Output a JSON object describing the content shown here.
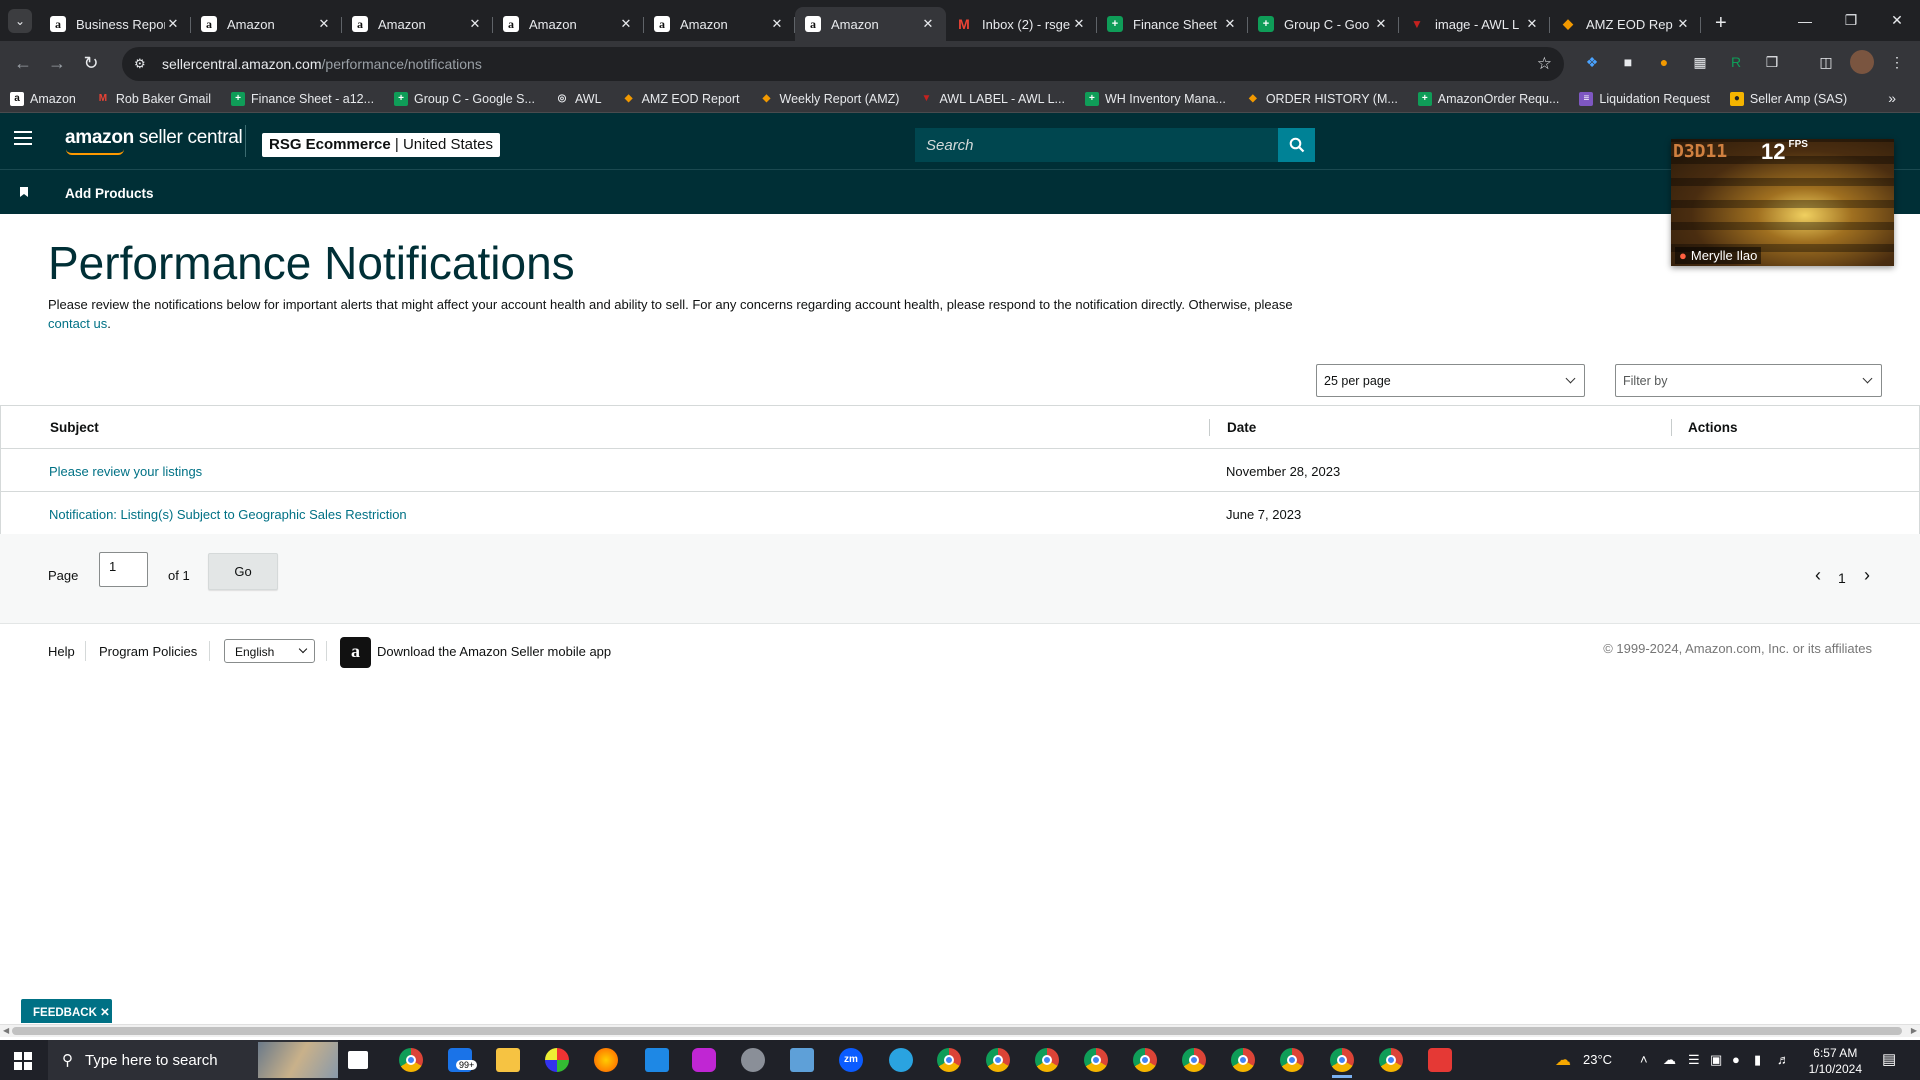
{
  "browser": {
    "tabs": [
      {
        "title": "Business Repor",
        "favicon": "amazon"
      },
      {
        "title": "Amazon",
        "favicon": "amazon"
      },
      {
        "title": "Amazon",
        "favicon": "amazon"
      },
      {
        "title": "Amazon",
        "favicon": "amazon"
      },
      {
        "title": "Amazon",
        "favicon": "amazon"
      },
      {
        "title": "Amazon",
        "favicon": "amazon",
        "active": true
      },
      {
        "title": "Inbox (2) - rsge",
        "favicon": "gmail"
      },
      {
        "title": "Finance Sheet",
        "favicon": "sheets"
      },
      {
        "title": "Group C - Goo",
        "favicon": "sheets"
      },
      {
        "title": "image - AWL L",
        "favicon": "awl"
      },
      {
        "title": "AMZ EOD Rep",
        "favicon": "eod"
      }
    ],
    "url_host": "sellercentral.amazon.com",
    "url_path": "/performance/notifications",
    "bookmarks": [
      {
        "label": "Amazon",
        "icon": "amazon"
      },
      {
        "label": "Rob Baker Gmail",
        "icon": "gmail"
      },
      {
        "label": "Finance Sheet - a12...",
        "icon": "sheets"
      },
      {
        "label": "Group C - Google S...",
        "icon": "sheets"
      },
      {
        "label": "AWL",
        "icon": "globe"
      },
      {
        "label": "AMZ EOD Report",
        "icon": "eod"
      },
      {
        "label": "Weekly Report (AMZ)",
        "icon": "eod"
      },
      {
        "label": "AWL LABEL - AWL L...",
        "icon": "awl"
      },
      {
        "label": "WH Inventory Mana...",
        "icon": "sheets"
      },
      {
        "label": "ORDER HISTORY (M...",
        "icon": "eod"
      },
      {
        "label": "AmazonOrder Requ...",
        "icon": "sheets"
      },
      {
        "label": "Liquidation Request",
        "icon": "forms"
      },
      {
        "label": "Seller Amp (SAS)",
        "icon": "selleramp"
      }
    ]
  },
  "header": {
    "logo_bold": "amazon",
    "logo_rest": " seller central",
    "store_name": "RSG Ecommerce",
    "store_sep": " | ",
    "store_region": "United States",
    "search_placeholder": "Search",
    "subnav_item": "Add Products"
  },
  "main": {
    "title": "Performance Notifications",
    "intro_text": "Please review the notifications below for important alerts that might affect your account health and ability to sell. For any concerns regarding account health, please respond to the notification directly. Otherwise, please ",
    "intro_link": "contact us",
    "intro_end": ".",
    "per_page": "25 per page",
    "filter_placeholder": "Filter by",
    "columns": {
      "subject": "Subject",
      "date": "Date",
      "actions": "Actions"
    },
    "rows": [
      {
        "subject": "Please review your listings",
        "date": "November 28, 2023"
      },
      {
        "subject": "Notification: Listing(s) Subject to Geographic Sales Restriction",
        "date": "June 7, 2023"
      }
    ],
    "pagination": {
      "page_label": "Page",
      "page_value": "1",
      "of_label": "of 1",
      "go_label": "Go",
      "prev": "‹",
      "current": "1",
      "next": "›"
    }
  },
  "footer": {
    "help": "Help",
    "policies": "Program Policies",
    "language": "English",
    "app_text": "Download the Amazon Seller mobile app",
    "copyright": "© 1999-2024, Amazon.com, Inc. or its affiliates"
  },
  "video_overlay": {
    "title": "D3D11",
    "fps": "12",
    "fps_unit": "FPS",
    "participant": "Merylle Ilao"
  },
  "feedback_label": "FEEDBACK",
  "taskbar": {
    "search_placeholder": "Type here to search",
    "weather": "23°C",
    "time": "6:57 AM",
    "date": "1/10/2024",
    "mail_badge": "99+"
  },
  "colors": {
    "header_bg": "#002f36",
    "link": "#007185",
    "search_button": "#008296",
    "title": "#002f36"
  }
}
